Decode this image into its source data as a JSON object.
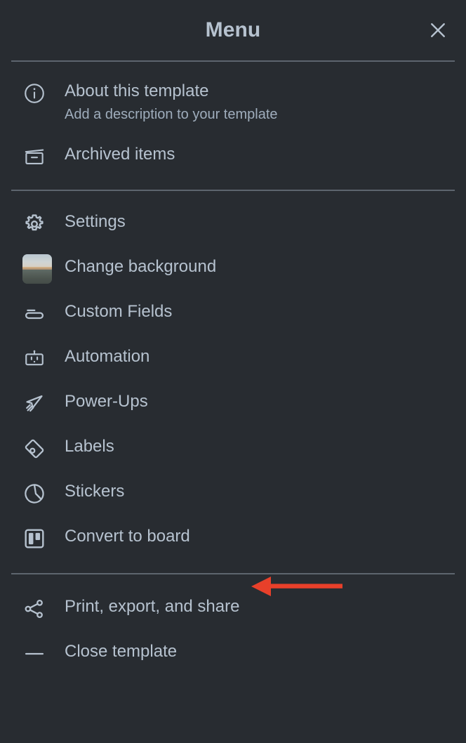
{
  "header": {
    "title": "Menu",
    "close_icon": "close-icon"
  },
  "sections": [
    {
      "id": "info",
      "items": [
        {
          "icon": "info-circle-icon",
          "label": "About this template",
          "sublabel": "Add a description to your template"
        },
        {
          "icon": "archive-box-icon",
          "label": "Archived items",
          "sublabel": ""
        }
      ]
    },
    {
      "id": "board-tools",
      "items": [
        {
          "icon": "gear-icon",
          "label": "Settings"
        },
        {
          "icon": "background-thumbnail-icon",
          "label": "Change background"
        },
        {
          "icon": "custom-fields-icon",
          "label": "Custom Fields"
        },
        {
          "icon": "robot-icon",
          "label": "Automation"
        },
        {
          "icon": "rocket-icon",
          "label": "Power-Ups"
        },
        {
          "icon": "label-tag-icon",
          "label": "Labels"
        },
        {
          "icon": "sticker-icon",
          "label": "Stickers"
        },
        {
          "icon": "board-icon",
          "label": "Convert to board"
        }
      ]
    },
    {
      "id": "actions",
      "items": [
        {
          "icon": "share-icon",
          "label": "Print, export, and share"
        },
        {
          "icon": "minus-icon",
          "label": "Close template"
        }
      ]
    }
  ],
  "annotation": {
    "type": "arrow-left",
    "color": "#e8402a",
    "points_at": "Convert to board"
  },
  "colors": {
    "background": "#282c31",
    "text": "#b6c2cf",
    "muted_text": "#9fadbc",
    "divider": "#5d656e",
    "accent_annotation": "#e8402a"
  }
}
